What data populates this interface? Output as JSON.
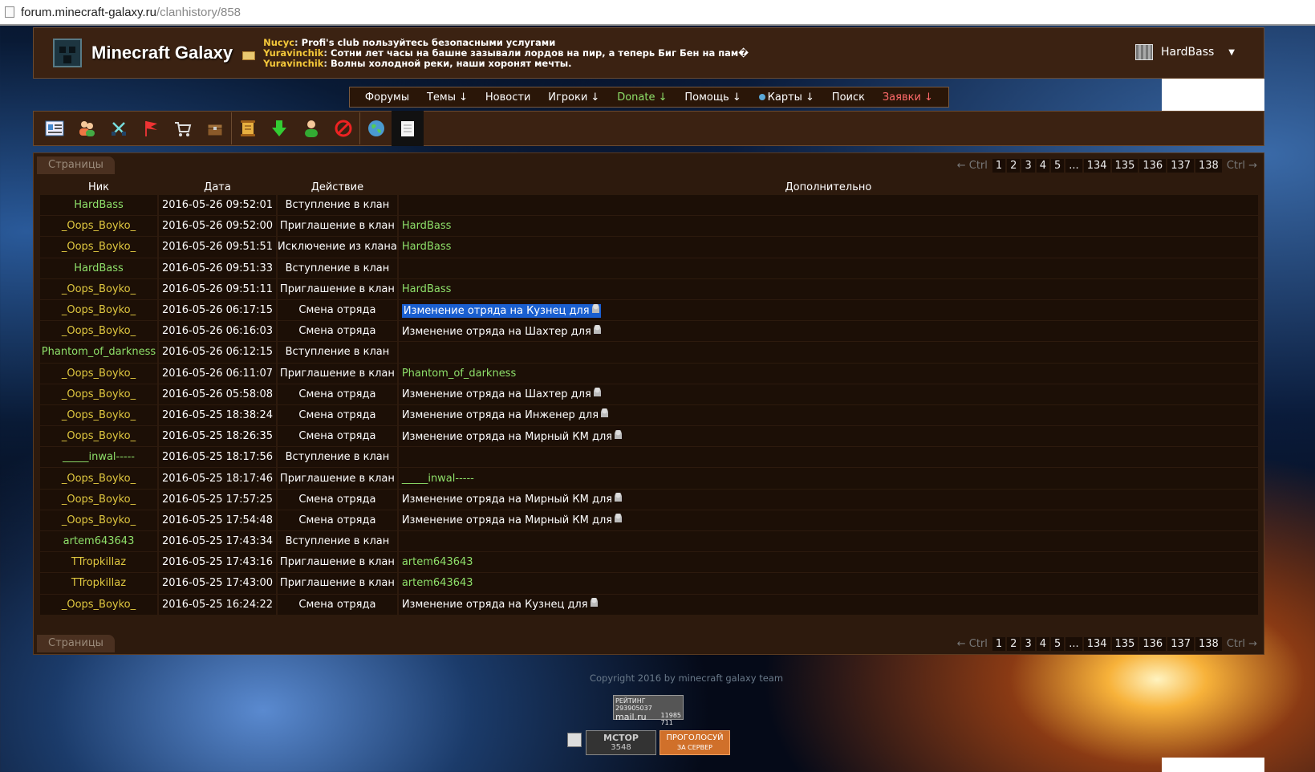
{
  "browser": {
    "host": "forum.minecraft-galaxy.ru",
    "path": "/clanhistory/858"
  },
  "header": {
    "site_title": "Minecraft Galaxy",
    "chat": [
      {
        "user": "Nucyc",
        "text": " Profi's club пользуйтесь безопасными услугами"
      },
      {
        "user": "Yuravinchik",
        "text": " Сотни лет часы на башне зазывали лордов на пир, а теперь Биг Бен на пам�"
      },
      {
        "user": "Yuravinchik",
        "text": " Волны холодной реки, наши хоронят мечты."
      }
    ],
    "username": "HardBass",
    "user_menu_arrow": "▼"
  },
  "nav": {
    "forums": "Форумы",
    "topics": "Темы ↓",
    "news": "Новости",
    "players": "Игроки ↓",
    "donate": "Donate ↓",
    "help": "Помощь ↓",
    "maps": "Карты ↓",
    "search": "Поиск",
    "requests": "Заявки ↓"
  },
  "toolbar_icons": [
    "profile-card-icon",
    "users-icon",
    "crossed-swords-icon",
    "clan-flag-icon",
    "shop-cart-icon",
    "chest-icon",
    "scroll-icon",
    "download-arrow-icon",
    "player-icon",
    "ban-icon",
    "globe-icon",
    "notepad-icon"
  ],
  "pager": {
    "label": "Страницы",
    "prev": "← Ctrl",
    "next": "Ctrl →",
    "pages": [
      "1",
      "2",
      "3",
      "4",
      "5",
      "...",
      "134",
      "135",
      "136",
      "137",
      "138"
    ]
  },
  "table": {
    "columns": [
      "Ник",
      "Дата",
      "Действие",
      "Дополнительно"
    ],
    "rows": [
      {
        "nick": "HardBass",
        "date": "2016-05-26 09:52:01",
        "action": "Вступление в клан",
        "extra": ""
      },
      {
        "nick": "_Oops_Boyko_",
        "date": "2016-05-26 09:52:00",
        "action": "Приглашение в клан",
        "extra": "HardBass"
      },
      {
        "nick": "_Oops_Boyko_",
        "date": "2016-05-26 09:51:51",
        "action": "Исключение из клана",
        "extra": "HardBass"
      },
      {
        "nick": "HardBass",
        "date": "2016-05-26 09:51:33",
        "action": "Вступление в клан",
        "extra": ""
      },
      {
        "nick": "_Oops_Boyko_",
        "date": "2016-05-26 09:51:11",
        "action": "Приглашение в клан",
        "extra": "HardBass"
      },
      {
        "nick": "_Oops_Boyko_",
        "date": "2016-05-26 06:17:15",
        "action": "Смена отряда",
        "extra": "Изменение отряда на Кузнец для"
      },
      {
        "nick": "_Oops_Boyko_",
        "date": "2016-05-26 06:16:03",
        "action": "Смена отряда",
        "extra": "Изменение отряда на Шахтер для"
      },
      {
        "nick": "Phantom_of_darkness",
        "date": "2016-05-26 06:12:15",
        "action": "Вступление в клан",
        "extra": ""
      },
      {
        "nick": "_Oops_Boyko_",
        "date": "2016-05-26 06:11:07",
        "action": "Приглашение в клан",
        "extra": "Phantom_of_darkness"
      },
      {
        "nick": "_Oops_Boyko_",
        "date": "2016-05-26 05:58:08",
        "action": "Смена отряда",
        "extra": "Изменение отряда на Шахтер для"
      },
      {
        "nick": "_Oops_Boyko_",
        "date": "2016-05-25 18:38:24",
        "action": "Смена отряда",
        "extra": "Изменение отряда на Инженер для"
      },
      {
        "nick": "_Oops_Boyko_",
        "date": "2016-05-25 18:26:35",
        "action": "Смена отряда",
        "extra": "Изменение отряда на Мирный КМ для"
      },
      {
        "nick": "_____inwal-----",
        "date": "2016-05-25 18:17:56",
        "action": "Вступление в клан",
        "extra": ""
      },
      {
        "nick": "_Oops_Boyko_",
        "date": "2016-05-25 18:17:46",
        "action": "Приглашение в клан",
        "extra": "_____inwal-----"
      },
      {
        "nick": "_Oops_Boyko_",
        "date": "2016-05-25 17:57:25",
        "action": "Смена отряда",
        "extra": "Изменение отряда на Мирный КМ для"
      },
      {
        "nick": "_Oops_Boyko_",
        "date": "2016-05-25 17:54:48",
        "action": "Смена отряда",
        "extra": "Изменение отряда на Мирный КМ для"
      },
      {
        "nick": "artem643643",
        "date": "2016-05-25 17:43:34",
        "action": "Вступление в клан",
        "extra": ""
      },
      {
        "nick": "TTropkillaz",
        "date": "2016-05-25 17:43:16",
        "action": "Приглашение в клан",
        "extra": "artem643643"
      },
      {
        "nick": "TTropkillaz",
        "date": "2016-05-25 17:43:00",
        "action": "Приглашение в клан",
        "extra": "artem643643"
      },
      {
        "nick": "_Oops_Boyko_",
        "date": "2016-05-25 16:24:22",
        "action": "Смена отряда",
        "extra": "Изменение отряда на Кузнец для"
      }
    ]
  },
  "footer": {
    "copyright": "Copyright 2016 by minecraft galaxy team",
    "rating_label": "РЕЙТИНГ 293905037",
    "rating_site": "mail.ru",
    "rating_n1": "11985",
    "rating_n2": "711",
    "mctop_label": "MCTOP",
    "mctop_count": "3548",
    "vote_line1": "ПРОГОЛОСУЙ",
    "vote_line2": "ЗА СЕРВЕР"
  },
  "colors": {
    "nick_green": "#8ee06a",
    "nick_yellow": "#e0c840",
    "header_bg": "#3b2212",
    "row_bg": "#1c0f06",
    "selection": "#1a5fd0"
  }
}
